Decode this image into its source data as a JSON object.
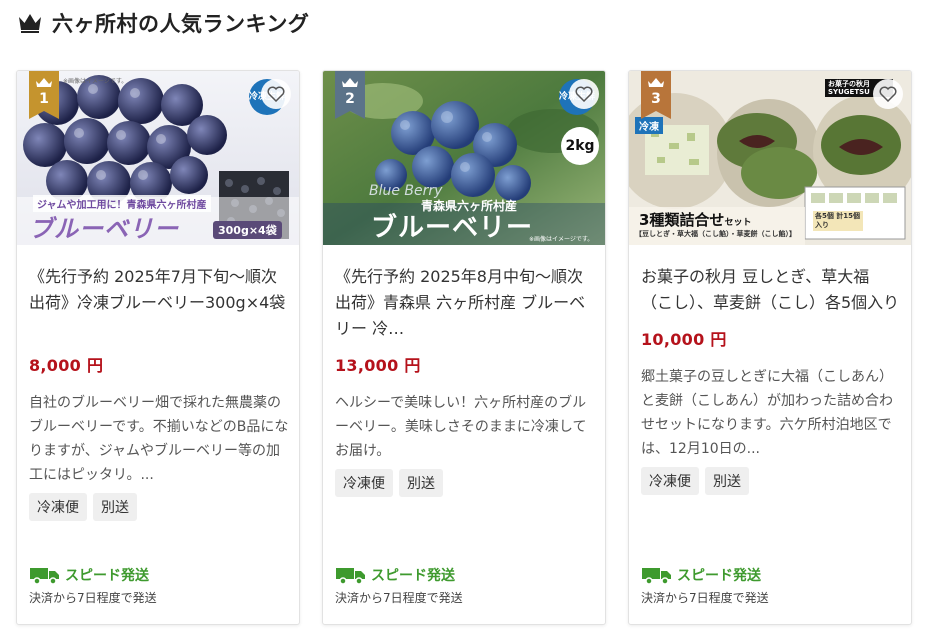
{
  "header": {
    "title": "六ヶ所村の人気ランキング",
    "icon": "crown-icon"
  },
  "cards": [
    {
      "rank": "1",
      "rank_color": "#c5942e",
      "badge": "冷凍生鮮",
      "img_caption": "ジャムや加工用に！青森県六ヶ所村産",
      "img_title": "ブルーベリー",
      "img_pack": "300g×4袋",
      "img_note": "※画像はイメージです。",
      "title": "《先行予約 2025年7月下旬～順次出荷》冷凍ブルーベリー300g×4袋",
      "price": "8,000 円",
      "desc": "自社のブルーベリー畑で採れた無農薬のブルーベリーです。不揃いなどのB品になりますが、ジャムやブルーベリー等の加工にはピッタリ。...",
      "tags": [
        "冷凍便",
        "別送"
      ],
      "shipping": {
        "label": "スピード発送",
        "note": "決済から7日程度で発送"
      }
    },
    {
      "rank": "2",
      "rank_color": "#5b7389",
      "badge": "冷凍生鮮",
      "img_caption": "青森県六ヶ所村産",
      "img_title": "ブルーベリー",
      "img_script": "Blue Berry",
      "img_weight": "2kg",
      "img_note": "※画像はイメージです。",
      "title": "《先行予約 2025年8月中旬～順次出荷》青森県 六ヶ所村産 ブルーベリー 冷…",
      "price": "13,000 円",
      "desc": "ヘルシーで美味しい！六ヶ所村産のブルーベリー。美味しさそのままに冷凍してお届け。",
      "tags": [
        "冷凍便",
        "別送"
      ],
      "shipping": {
        "label": "スピード発送",
        "note": "決済から7日程度で発送"
      }
    },
    {
      "rank": "3",
      "rank_color": "#b8753a",
      "badge": "冷凍",
      "img_brand": "お菓子の秋月 SYUGETSU",
      "img_title": "3種類詰合せ",
      "img_title_suffix": "セット",
      "img_caption": "【豆しとぎ・草大福（こし餡）・草麦餅（こし餡）】",
      "img_count": "各5個 計15個入り",
      "title": "お菓子の秋月 豆しとぎ、草大福（こし）、草麦餅（こし）各5個入り",
      "price": "10,000 円",
      "desc": "郷土菓子の豆しとぎに大福（こしあん）と麦餅（こしあん）が加わった詰め合わせセットになります。六ケ所村泊地区では、12月10日の...",
      "tags": [
        "冷凍便",
        "別送"
      ],
      "shipping": {
        "label": "スピード発送",
        "note": "決済から7日程度で発送"
      }
    }
  ],
  "colors": {
    "price": "#b5121b",
    "shipping": "#3e9a2e",
    "badge": "#1e73b9"
  }
}
